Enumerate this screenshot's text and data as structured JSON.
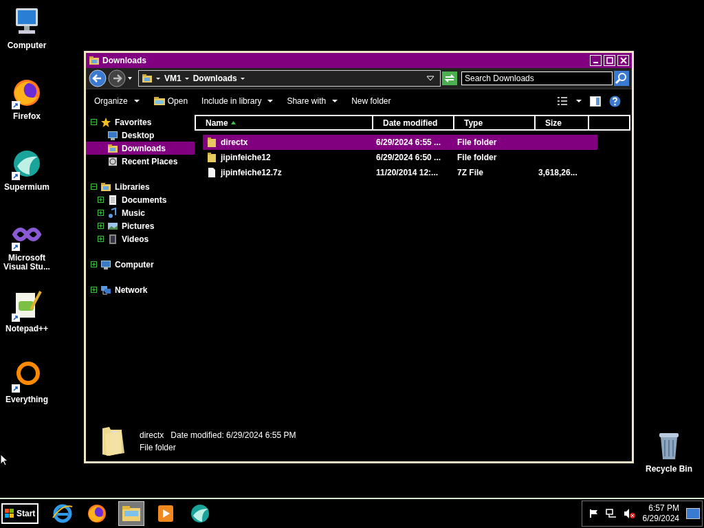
{
  "desktop_icons": [
    {
      "kind": "computer",
      "label": "Computer",
      "shortcut": false
    },
    {
      "kind": "firefox",
      "label": "Firefox",
      "shortcut": true
    },
    {
      "kind": "supermium",
      "label": "Supermium",
      "shortcut": true
    },
    {
      "kind": "visualstudio",
      "label": "Microsoft Visual Stu...",
      "shortcut": true
    },
    {
      "kind": "notepad",
      "label": "Notepad++",
      "shortcut": true
    },
    {
      "kind": "everything",
      "label": "Everything",
      "shortcut": true
    },
    {
      "kind": "recycle",
      "label": "Recycle Bin",
      "shortcut": false
    }
  ],
  "window": {
    "title": "Downloads",
    "breadcrumb": [
      "VM1",
      "Downloads"
    ],
    "search": {
      "placeholder": "Search Downloads"
    },
    "toolbar": [
      {
        "label": "Organize",
        "menu": true,
        "icon": false
      },
      {
        "label": "Open",
        "menu": false,
        "icon": true
      },
      {
        "label": "Include in library",
        "menu": true,
        "icon": false
      },
      {
        "label": "Share with",
        "menu": true,
        "icon": false
      },
      {
        "label": "New folder",
        "menu": false,
        "icon": false
      }
    ],
    "nav": [
      {
        "label": "Favorites",
        "kind": "star",
        "expanded": true,
        "selected": false,
        "children": [
          {
            "label": "Desktop",
            "kind": "desktop",
            "selected": false
          },
          {
            "label": "Downloads",
            "kind": "downloads",
            "selected": true
          },
          {
            "label": "Recent Places",
            "kind": "recent",
            "selected": false
          }
        ]
      },
      {
        "label": "Libraries",
        "kind": "libraries",
        "expanded": true,
        "selected": false,
        "children": [
          {
            "label": "Documents",
            "kind": "documents",
            "expanded": false,
            "selected": false
          },
          {
            "label": "Music",
            "kind": "music",
            "expanded": false,
            "selected": false
          },
          {
            "label": "Pictures",
            "kind": "pictures",
            "expanded": false,
            "selected": false
          },
          {
            "label": "Videos",
            "kind": "videos",
            "expanded": false,
            "selected": false
          }
        ]
      },
      {
        "label": "Computer",
        "kind": "computer",
        "expanded": false,
        "selected": false
      },
      {
        "label": "Network",
        "kind": "network",
        "expanded": false,
        "selected": false
      }
    ],
    "columns": [
      {
        "label": "Name",
        "sorted": true
      },
      {
        "label": "Date modified",
        "sorted": false
      },
      {
        "label": "Type",
        "sorted": false
      },
      {
        "label": "Size",
        "sorted": false
      }
    ],
    "rows": [
      {
        "kind": "folder",
        "name": "directx",
        "date": "6/29/2024 6:55 ...",
        "type": "File folder",
        "selected": true
      },
      {
        "kind": "folder",
        "name": "jipinfeiche12",
        "date": "6/29/2024 6:50 ...",
        "type": "File folder",
        "selected": false
      },
      {
        "kind": "file",
        "name": "jipinfeiche12.7z",
        "date": "11/20/2014 12:...",
        "type": "7Z File",
        "size": "3,618,26...",
        "selected": false
      }
    ],
    "details": {
      "name": "directx",
      "modified": "Date modified: 6/29/2024 6:55 PM",
      "type": "File folder"
    }
  },
  "taskbar": {
    "start": "Start",
    "apps": [
      {
        "kind": "ie",
        "active": false
      },
      {
        "kind": "firefox",
        "active": false
      },
      {
        "kind": "explorer",
        "active": true
      },
      {
        "kind": "media",
        "active": false
      },
      {
        "kind": "supermium",
        "active": false
      }
    ],
    "time": "6:57 PM",
    "date": "6/29/2024"
  }
}
